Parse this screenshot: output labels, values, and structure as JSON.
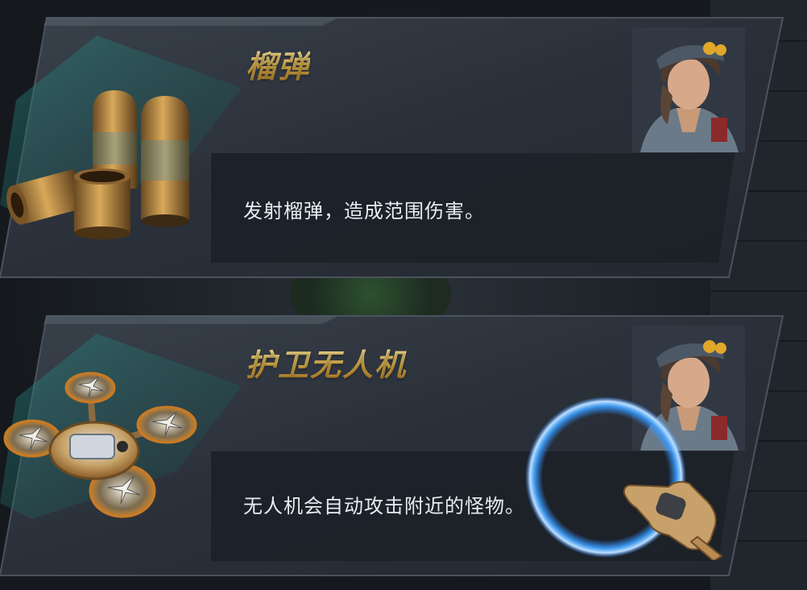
{
  "cards": [
    {
      "title": "榴弹",
      "description": "发射榴弹，造成范围伤害。",
      "item_icon": "grenade-shells-icon",
      "portrait": "character-portrait"
    },
    {
      "title": "护卫无人机",
      "description": "无人机会自动攻击附近的怪物。",
      "item_icon": "guard-drone-icon",
      "portrait": "character-portrait"
    }
  ],
  "tutorial": {
    "pointer_icon": "glove-pointer-icon",
    "highlight": "blue-highlight-ring"
  },
  "colors": {
    "title_gold": "#e0b34a",
    "panel_dark": "#2b323b",
    "desc_box": "#1e242b",
    "accent_teal": "#1f6f6a",
    "ring_blue": "#2f8cff"
  }
}
